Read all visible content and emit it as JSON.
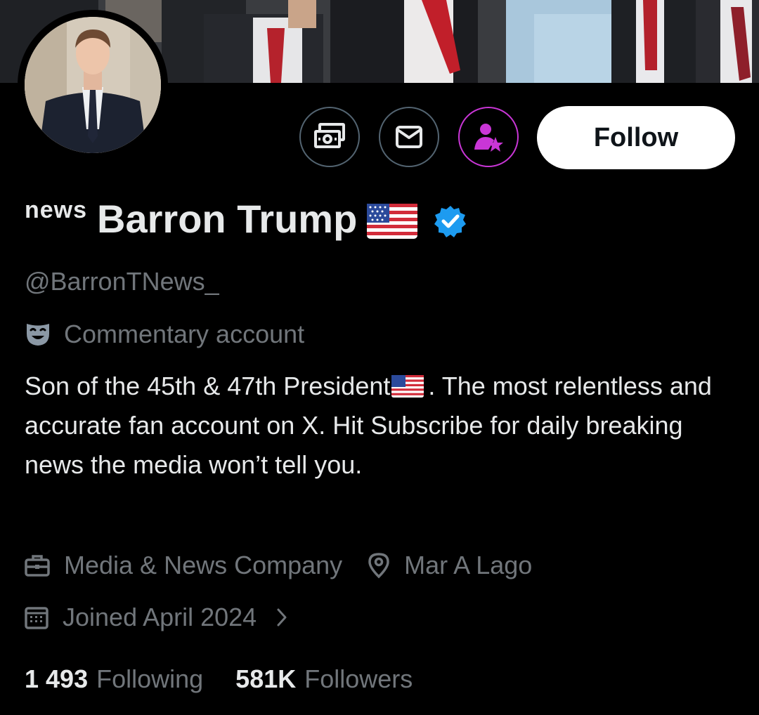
{
  "profile": {
    "name_prefix": "news",
    "display_name": "Barron Trump",
    "handle": "@BarronTNews_",
    "account_label": "Commentary account",
    "bio_part1": "Son of the 45th & 47th President",
    "bio_part2": ". The most relentless and accurate fan account on X. Hit Subscribe for daily breaking news the media won’t tell you.",
    "category": "Media & News Company",
    "location": "Mar A Lago",
    "joined": "Joined April 2024"
  },
  "actions": {
    "follow_label": "Follow",
    "tip_icon": "money-icon",
    "message_icon": "envelope-icon",
    "subscribe_icon": "person-star-icon"
  },
  "stats": {
    "following_count": "1 493",
    "following_label": "Following",
    "followers_count": "581K",
    "followers_label": "Followers"
  },
  "colors": {
    "background": "#000000",
    "text_primary": "#e7e9ea",
    "text_secondary": "#71767b",
    "verified_blue": "#1d9bf0",
    "subscribe_purple": "#c936d6"
  }
}
